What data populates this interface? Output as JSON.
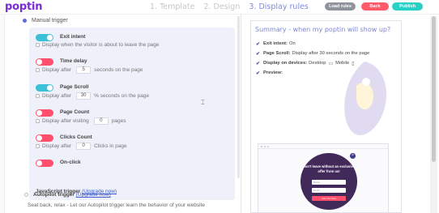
{
  "header": {
    "logo": "poptin",
    "steps": [
      {
        "label": "1. Template",
        "active": false
      },
      {
        "label": "2. Design",
        "active": false
      },
      {
        "label": "3. Display rules",
        "active": true
      }
    ],
    "buttons": {
      "load_rules": "Load rules",
      "back": "Back",
      "publish": "Publish"
    }
  },
  "left": {
    "manual_trigger": "Manual trigger",
    "rules": {
      "exit_intent": {
        "title": "Exit intent",
        "enabled": true,
        "desc": "Display when the visitor is about to leave the page"
      },
      "time_delay": {
        "title": "Time delay",
        "enabled": false,
        "prefix": "Display after",
        "value": "5",
        "suffix": "seconds on the page"
      },
      "page_scroll": {
        "title": "Page Scroll",
        "enabled": true,
        "prefix": "Display after",
        "value": "30",
        "suffix": "% seconds on the page"
      },
      "page_count": {
        "title": "Page Count",
        "enabled": false,
        "prefix": "Display after visiting",
        "value": "0",
        "suffix": "pages"
      },
      "clicks_count": {
        "title": "Clicks Count",
        "enabled": false,
        "prefix": "Display after",
        "value": "0",
        "suffix": "Clicks in page"
      },
      "on_click": {
        "title": "On-click",
        "enabled": false
      }
    },
    "js_trigger": {
      "label": "JavaScript trigger",
      "link": "(Upgrade now)"
    },
    "autopilot": {
      "label": "Autopilot trigger",
      "link": "(Upgrade now)"
    },
    "autopilot_desc": "Seat back, relax - Let our Autopilot trigger learn the behavior of your website"
  },
  "summary": {
    "title": "Summary - when my poptin will show up?",
    "items": [
      {
        "label": "Exit intent:",
        "value": "On"
      },
      {
        "label": "Page Scroll:",
        "value": "Display after 30 seconds on the page"
      },
      {
        "label": "Display on devices:",
        "desktop": "Desktop",
        "mobile": "Mobile"
      },
      {
        "label": "Preview:",
        "value": ""
      }
    ],
    "icons": {
      "check": "check-icon",
      "desktop": "desktop-icon",
      "mobile": "mobile-icon"
    }
  },
  "preview": {
    "headline": "Don't leave without an exclusive offer from us!",
    "name_placeholder": "Name",
    "email_placeholder": "Email",
    "cta": "Get it for free"
  },
  "colors": {
    "brand": "#7a2bd6",
    "active_step": "#7b8cde",
    "toggle_on": "#3cc0d8",
    "toggle_off": "#ff4f6d",
    "publish": "#2ad0c6",
    "back": "#ff5a6a"
  }
}
